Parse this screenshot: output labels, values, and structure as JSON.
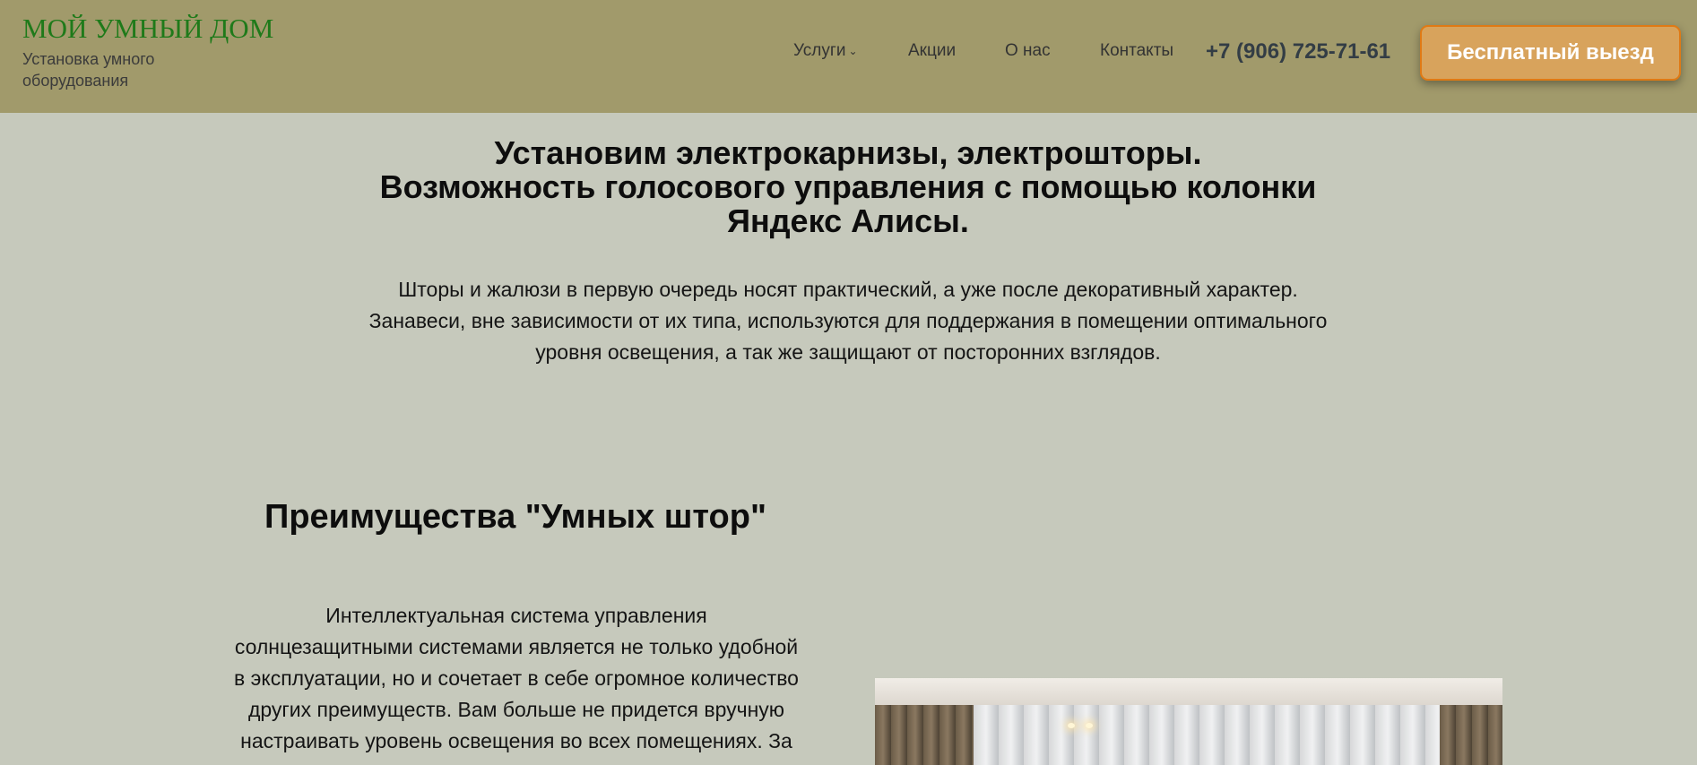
{
  "header": {
    "logo_title": "МОЙ УМНЫЙ ДОМ",
    "logo_subtitle": "Установка умного оборудования",
    "nav": [
      {
        "label": "Услуги",
        "has_dropdown": true
      },
      {
        "label": "Акции"
      },
      {
        "label": "О нас"
      },
      {
        "label": "Контакты"
      }
    ],
    "phone": "+7 (906) 725-71-61",
    "cta_label": "Бесплатный выезд"
  },
  "hero": {
    "title_lines": [
      "Установим электрокарнизы, электрошторы.",
      "Возможность голосового управления с помощью колонки",
      "Яндекс Алисы."
    ],
    "text_lines": [
      "Шторы и жалюзи в первую очередь носят практический, а уже после декоративный характер.",
      "Занавеси, вне зависимости от их типа, используются для поддержания в помещении оптимального",
      "уровня освещения, а так же защищают от посторонних взглядов."
    ]
  },
  "advantages": {
    "title": "Преимущества \"Умных штор\"",
    "text_lines": [
      "Интеллектуальная система управления",
      "солнцезащитными системами является не только удобной",
      "в эксплуатации, но и сочетает в себе огромное количество",
      "других преимуществ. Вам больше не придется вручную",
      "настраивать уровень освещения во всех помещениях. За"
    ]
  },
  "colors": {
    "header_bg": "#a19a6b",
    "page_bg": "#c6c9bc",
    "logo_green": "#1f7a1a",
    "cta_bg": "#d8a35c",
    "cta_border": "#e07a14"
  },
  "icons": {
    "dropdown": "chevron-down-icon"
  }
}
